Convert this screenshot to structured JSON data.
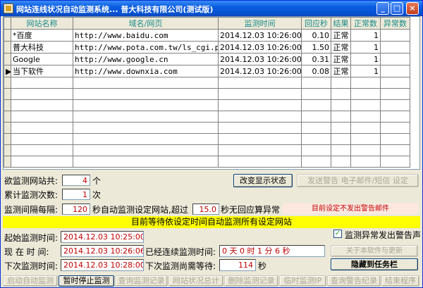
{
  "window": {
    "title": "网站连线状况自动监测系统...  普大科技有限公司(测试版)",
    "min_glyph": "_",
    "max_glyph": "□",
    "close_glyph": "×"
  },
  "grid": {
    "columns": [
      "网站名称",
      "域名/网页",
      "监测时间",
      "回应秒",
      "结果",
      "正常数",
      "异常数"
    ],
    "rows": [
      {
        "marker": "",
        "name": "*百度",
        "url": "http://www.baidu.com",
        "time": "2014.12.03 10:26:00",
        "response": "0.10",
        "result": "正常",
        "normal": "1",
        "abnormal": ""
      },
      {
        "marker": "",
        "name": "普大科技",
        "url": "http://www.pota.com.tw/ls_cgi.phpx?cfi",
        "time": "2014.12.03 10:26:00",
        "response": "1.50",
        "result": "正常",
        "normal": "1",
        "abnormal": ""
      },
      {
        "marker": "",
        "name": "Google",
        "url": "http://www.google.cn",
        "time": "2014.12.03 10:26:00",
        "response": "0.31",
        "result": "正常",
        "normal": "1",
        "abnormal": ""
      },
      {
        "marker": "▶",
        "name": "当下软件",
        "url": "http://www.downxia.com",
        "time": "2014.12.03 10:26:00",
        "response": "0.08",
        "result": "正常",
        "normal": "1",
        "abnormal": ""
      }
    ],
    "empty_rows": 8
  },
  "stats": {
    "site_count_label": "欲监测网站共:",
    "site_count_value": "4",
    "site_count_unit": "个",
    "total_label": "累计监测次数:",
    "total_value": "1",
    "total_unit": "次",
    "interval_label": "监测间隔每隔:",
    "interval_value": "120",
    "interval_text": "秒自动监测设定网站,超过",
    "timeout_value": "15.0",
    "timeout_text": "秒无回应算异常"
  },
  "buttons": {
    "change_display": "改变显示状态",
    "send_alert": "发送警告 电子邮件/短信 设定",
    "about": "关于本软件与更新",
    "hide_tray": "隐藏到任务栏"
  },
  "notice": "目前设定不发出警告邮件",
  "banner": "目前等待依设定时间自动监测所有设定网站",
  "times": {
    "start_label": "起始监测时间:",
    "start_value": "2014.12.03 10:25:00",
    "now_label": "现  在  时  间:",
    "now_value": "2014.12.03 10:26:06",
    "elapsed_label": "已经连续监测时间:",
    "elapsed_value": "0 天   0 时   1 分   6 秒",
    "next_label": "下次监测时间:",
    "next_value": "2014.12.03 10:28:00",
    "wait_label": "下次监测尚需等待:",
    "wait_value": "114",
    "wait_unit": "秒"
  },
  "alert_checkbox": {
    "label": "监测异常发出警告声",
    "checked_glyph": "✓"
  },
  "bottom_bar": [
    "启动自动监测",
    "暂时停止监测",
    "查询监测记录",
    "网站状况总计",
    "删除监测记录",
    "临时监测IP",
    "查询警告纪录",
    "结束程序"
  ]
}
